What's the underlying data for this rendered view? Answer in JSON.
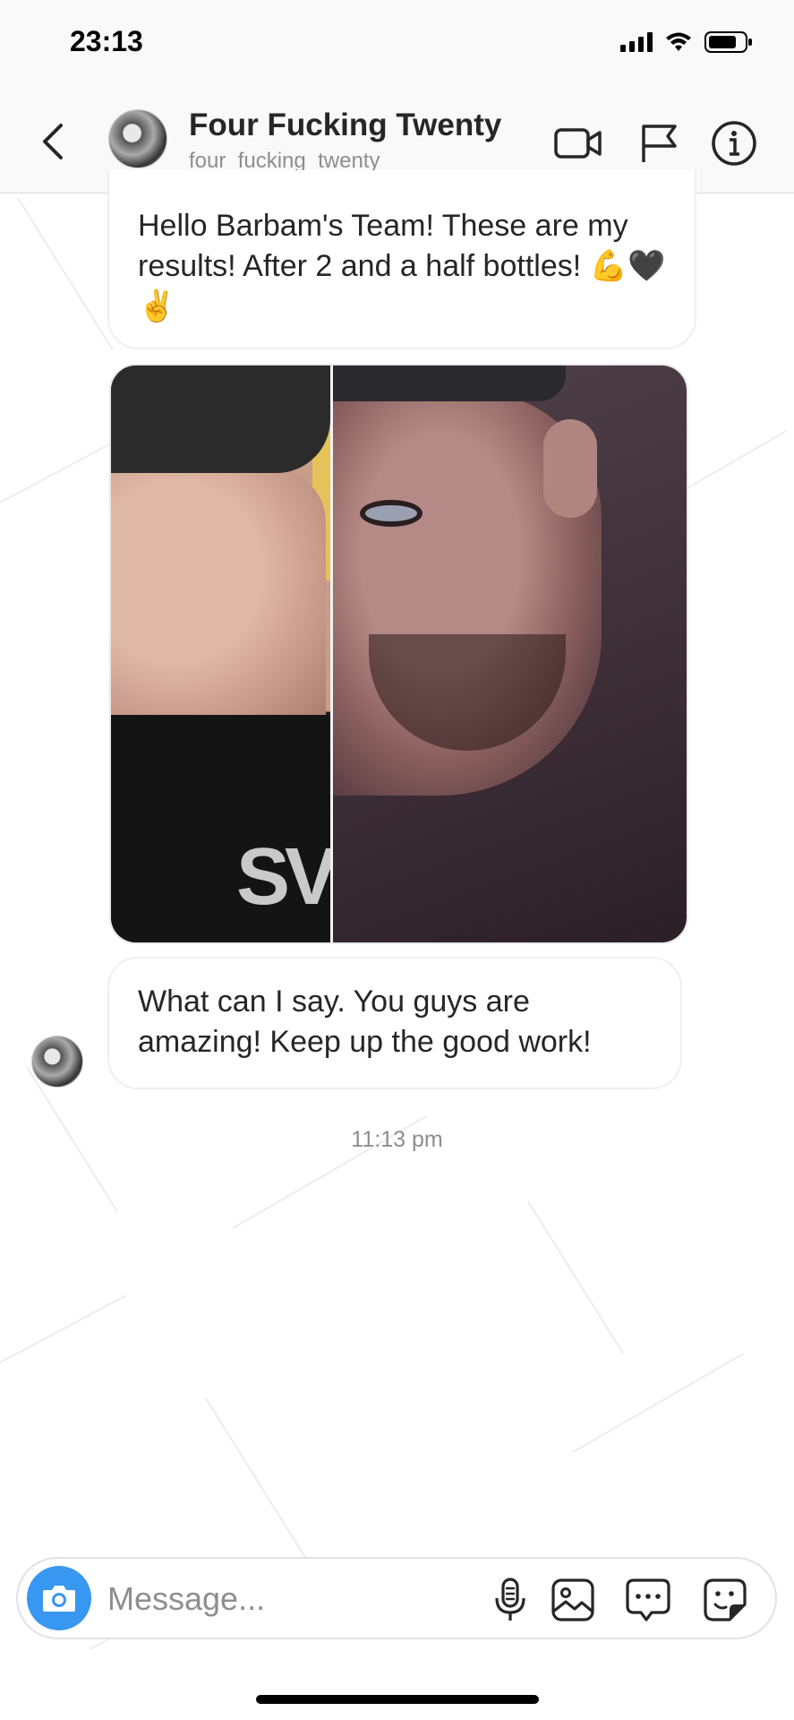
{
  "status_bar": {
    "time": "23:13"
  },
  "header": {
    "title": "Four Fucking Twenty",
    "username": "four_fucking_twenty"
  },
  "messages": [
    {
      "type": "text",
      "text": "Hello Barbam's Team! These are my results! After 2 and a half bottles! 💪🖤✌️"
    },
    {
      "type": "photo"
    },
    {
      "type": "text",
      "text": "What can I say. You guys are amazing! Keep up the good work!"
    }
  ],
  "timestamp": "11:13 pm",
  "composer": {
    "placeholder": "Message..."
  },
  "colors": {
    "accent": "#3897f0",
    "bubble_border": "#efefef",
    "muted_text": "#8e8e8e"
  }
}
